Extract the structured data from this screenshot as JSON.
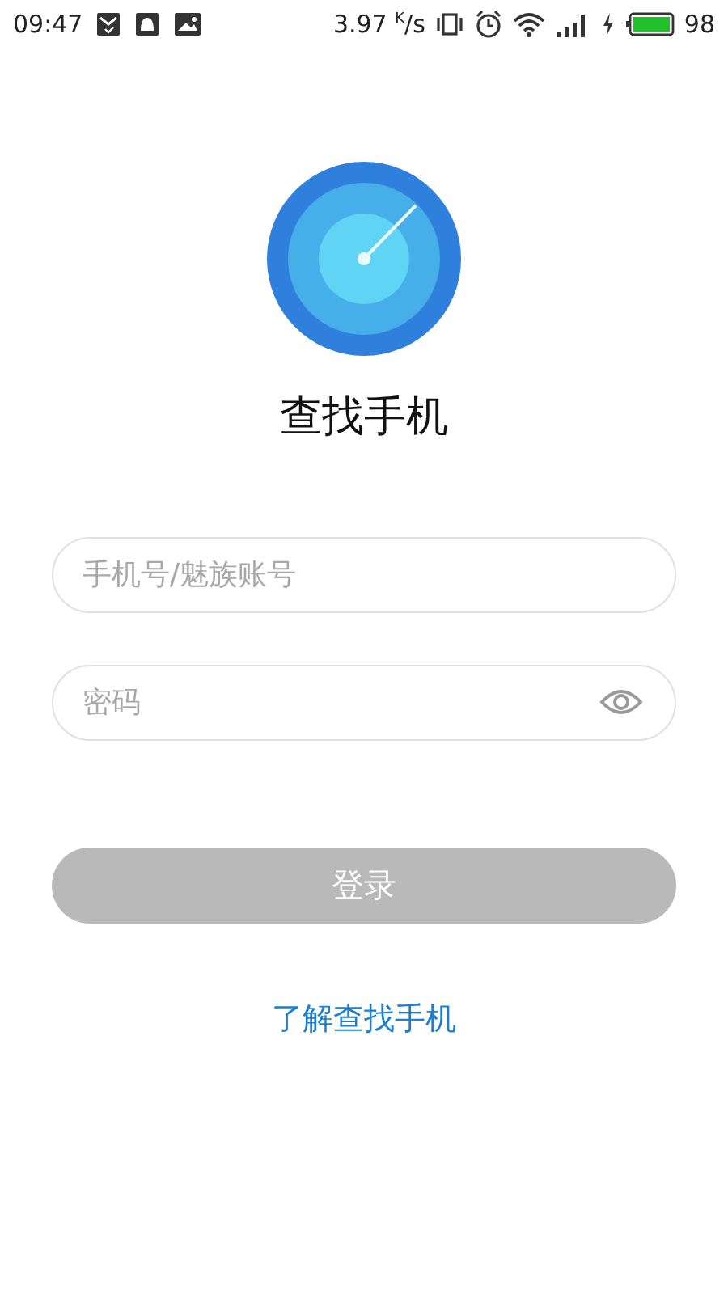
{
  "status_bar": {
    "time": "09:47",
    "speed": "3.97 $^{K}$/s",
    "battery": "98"
  },
  "app": {
    "title": "查找手机"
  },
  "fields": [
    {
      "kind": "text",
      "placeholder": "手机号/魅族账号"
    },
    {
      "kind": "password",
      "placeholder": "密码"
    }
  ],
  "login_button": {
    "label": "登录",
    "disabled": true
  },
  "link": "了解查找手机"
}
